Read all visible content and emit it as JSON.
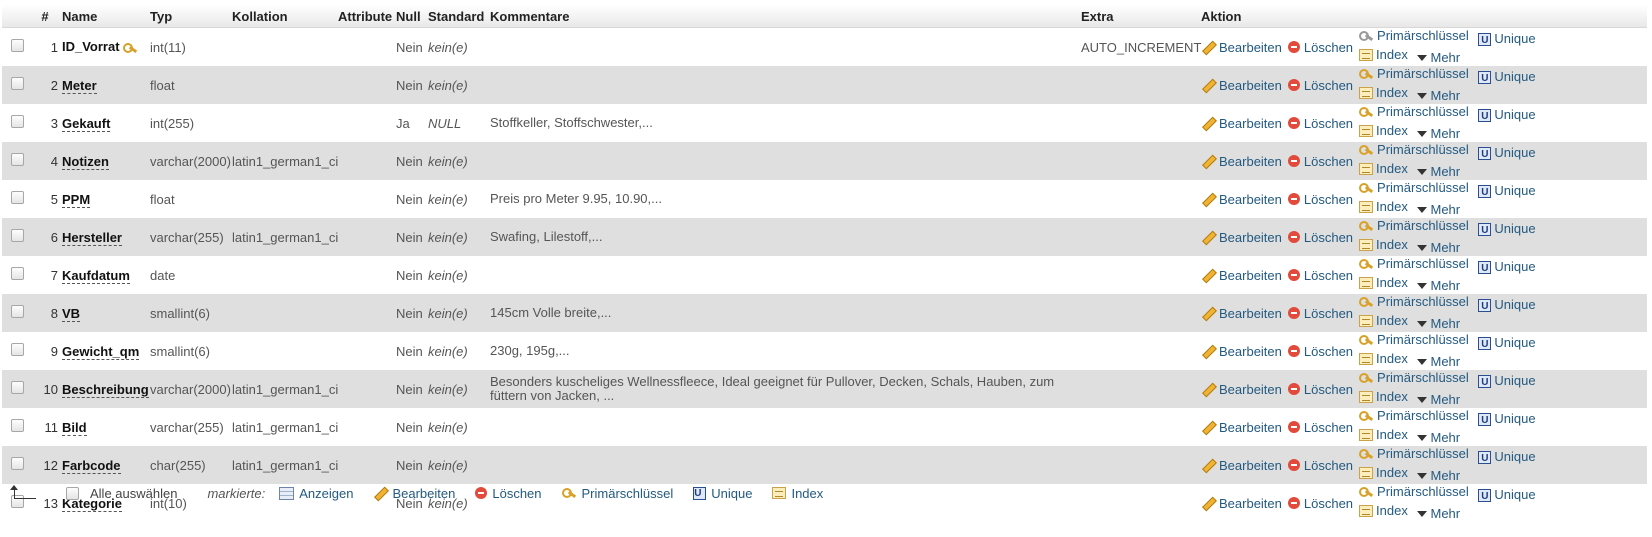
{
  "headers": {
    "num": "#",
    "name": "Name",
    "type": "Typ",
    "collation": "Kollation",
    "attributes": "Attribute",
    "null": "Null",
    "default": "Standard",
    "comments": "Kommentare",
    "extra": "Extra",
    "action": "Aktion"
  },
  "actions": {
    "edit": "Bearbeiten",
    "delete": "Löschen",
    "primary": "Primärschlüssel",
    "unique": "Unique",
    "index": "Index",
    "more": "Mehr"
  },
  "rows": [
    {
      "num": "1",
      "name": "ID_Vorrat",
      "type": "int(11)",
      "collation": "",
      "attributes": "",
      "null": "Nein",
      "default": "kein(e)",
      "comment": "",
      "extra": "AUTO_INCREMENT",
      "is_primary": true
    },
    {
      "num": "2",
      "name": "Meter",
      "type": "float",
      "collation": "",
      "attributes": "",
      "null": "Nein",
      "default": "kein(e)",
      "comment": "",
      "extra": ""
    },
    {
      "num": "3",
      "name": "Gekauft",
      "type": "int(255)",
      "collation": "",
      "attributes": "",
      "null": "Ja",
      "default": "NULL",
      "comment": "Stoffkeller, Stoffschwester,...",
      "extra": ""
    },
    {
      "num": "4",
      "name": "Notizen",
      "type": "varchar(2000)",
      "collation": "latin1_german1_ci",
      "attributes": "",
      "null": "Nein",
      "default": "kein(e)",
      "comment": "",
      "extra": ""
    },
    {
      "num": "5",
      "name": "PPM",
      "type": "float",
      "collation": "",
      "attributes": "",
      "null": "Nein",
      "default": "kein(e)",
      "comment": "Preis pro Meter 9.95, 10.90,...",
      "extra": ""
    },
    {
      "num": "6",
      "name": "Hersteller",
      "type": "varchar(255)",
      "collation": "latin1_german1_ci",
      "attributes": "",
      "null": "Nein",
      "default": "kein(e)",
      "comment": "Swafing, Lilestoff,...",
      "extra": ""
    },
    {
      "num": "7",
      "name": "Kaufdatum",
      "type": "date",
      "collation": "",
      "attributes": "",
      "null": "Nein",
      "default": "kein(e)",
      "comment": "",
      "extra": ""
    },
    {
      "num": "8",
      "name": "VB",
      "type": "smallint(6)",
      "collation": "",
      "attributes": "",
      "null": "Nein",
      "default": "kein(e)",
      "comment": "145cm Volle breite,...",
      "extra": ""
    },
    {
      "num": "9",
      "name": "Gewicht_qm",
      "type": "smallint(6)",
      "collation": "",
      "attributes": "",
      "null": "Nein",
      "default": "kein(e)",
      "comment": "230g, 195g,...",
      "extra": ""
    },
    {
      "num": "10",
      "name": "Beschreibung",
      "type": "varchar(2000)",
      "collation": "latin1_german1_ci",
      "attributes": "",
      "null": "Nein",
      "default": "kein(e)",
      "comment": "Besonders kuscheliges Wellnessfleece, Ideal geeignet für Pullover, Decken, Schals, Hauben, zum füttern von Jacken, ...",
      "extra": ""
    },
    {
      "num": "11",
      "name": "Bild",
      "type": "varchar(255)",
      "collation": "latin1_german1_ci",
      "attributes": "",
      "null": "Nein",
      "default": "kein(e)",
      "comment": "",
      "extra": ""
    },
    {
      "num": "12",
      "name": "Farbcode",
      "type": "char(255)",
      "collation": "latin1_german1_ci",
      "attributes": "",
      "null": "Nein",
      "default": "kein(e)",
      "comment": "",
      "extra": ""
    },
    {
      "num": "13",
      "name": "Kategorie",
      "type": "int(10)",
      "collation": "",
      "attributes": "",
      "null": "Nein",
      "default": "kein(e)",
      "comment": "",
      "extra": ""
    }
  ],
  "footer": {
    "select_all": "Alle auswählen",
    "marked": "markierte:",
    "browse": "Anzeigen",
    "edit": "Bearbeiten",
    "delete": "Löschen",
    "primary": "Primärschlüssel",
    "unique": "Unique",
    "index": "Index"
  }
}
